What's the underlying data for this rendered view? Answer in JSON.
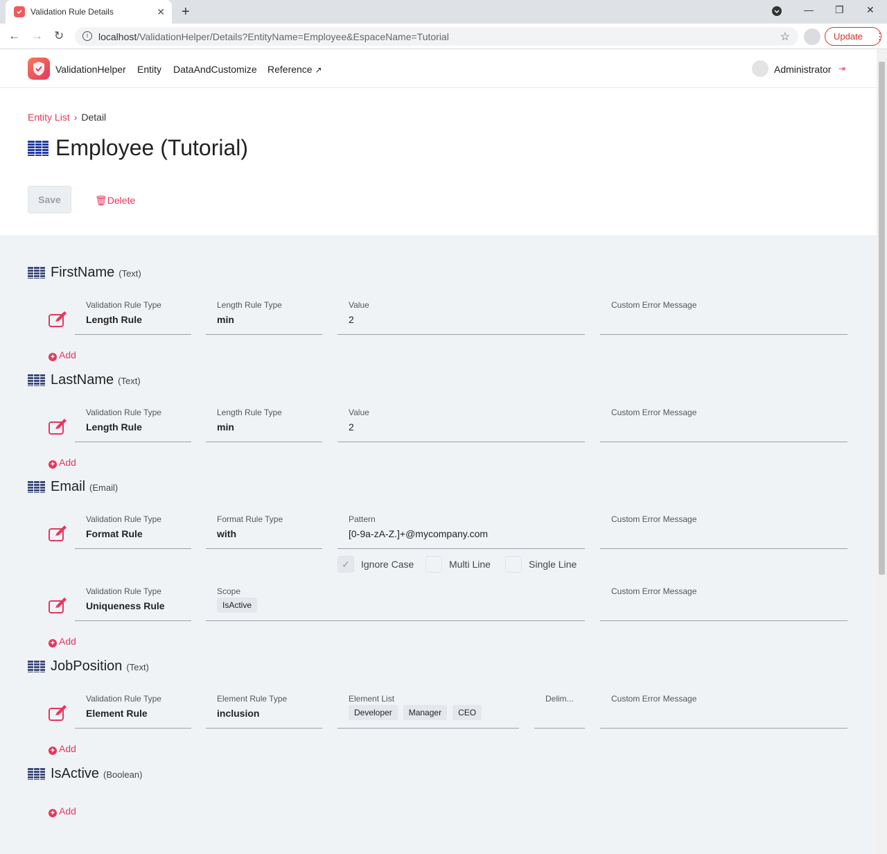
{
  "browser": {
    "tab_title": "Validation Rule Details",
    "url_host": "localhost",
    "url_path": "/ValidationHelper/Details?EntityName=Employee&EspaceName=Tutorial",
    "update_label": "Update"
  },
  "header": {
    "brand": "ValidationHelper",
    "menu": [
      "Entity",
      "DataAndCustomize",
      "Reference"
    ],
    "user": "Administrator"
  },
  "breadcrumb": {
    "link": "Entity List",
    "sep": "›",
    "current": "Detail"
  },
  "page_title": "Employee (Tutorial)",
  "actions": {
    "save": "Save",
    "delete": "Delete"
  },
  "add_label": "Add",
  "attributes": [
    {
      "name": "FirstName",
      "type": "(Text)",
      "rules": [
        {
          "validation_label": "Validation Rule Type",
          "validation_value": "Length Rule",
          "sub_label": "Length Rule Type",
          "sub_value": "min",
          "value_label": "Value",
          "value": "2",
          "error_label": "Custom Error Message",
          "error_value": ""
        }
      ]
    },
    {
      "name": "LastName",
      "type": "(Text)",
      "rules": [
        {
          "validation_label": "Validation Rule Type",
          "validation_value": "Length Rule",
          "sub_label": "Length Rule Type",
          "sub_value": "min",
          "value_label": "Value",
          "value": "2",
          "error_label": "Custom Error Message",
          "error_value": ""
        }
      ]
    },
    {
      "name": "Email",
      "type": "(Email)",
      "rules": [
        {
          "validation_label": "Validation Rule Type",
          "validation_value": "Format Rule",
          "sub_label": "Format Rule Type",
          "sub_value": "with",
          "value_label": "Pattern",
          "value": "[0-9a-zA-Z.]+@mycompany.com",
          "error_label": "Custom Error Message",
          "error_value": "",
          "options": [
            {
              "label": "Ignore Case",
              "checked": true
            },
            {
              "label": "Multi Line",
              "checked": false
            },
            {
              "label": "Single Line",
              "checked": false
            }
          ]
        },
        {
          "validation_label": "Validation Rule Type",
          "validation_value": "Uniqueness Rule",
          "scope_label": "Scope",
          "scope_chips": [
            "IsActive"
          ],
          "error_label": "Custom Error Message",
          "error_value": ""
        }
      ]
    },
    {
      "name": "JobPosition",
      "type": "(Text)",
      "rules": [
        {
          "validation_label": "Validation Rule Type",
          "validation_value": "Element Rule",
          "sub_label": "Element Rule Type",
          "sub_value": "inclusion",
          "list_label": "Element List",
          "list_chips": [
            "Developer",
            "Manager",
            "CEO"
          ],
          "delim_label": "Delim...",
          "error_label": "Custom Error Message",
          "error_value": ""
        }
      ]
    },
    {
      "name": "IsActive",
      "type": "(Boolean)",
      "rules": []
    }
  ],
  "colors": {
    "accent": "#e8365d",
    "background": "#f0f3f6"
  }
}
